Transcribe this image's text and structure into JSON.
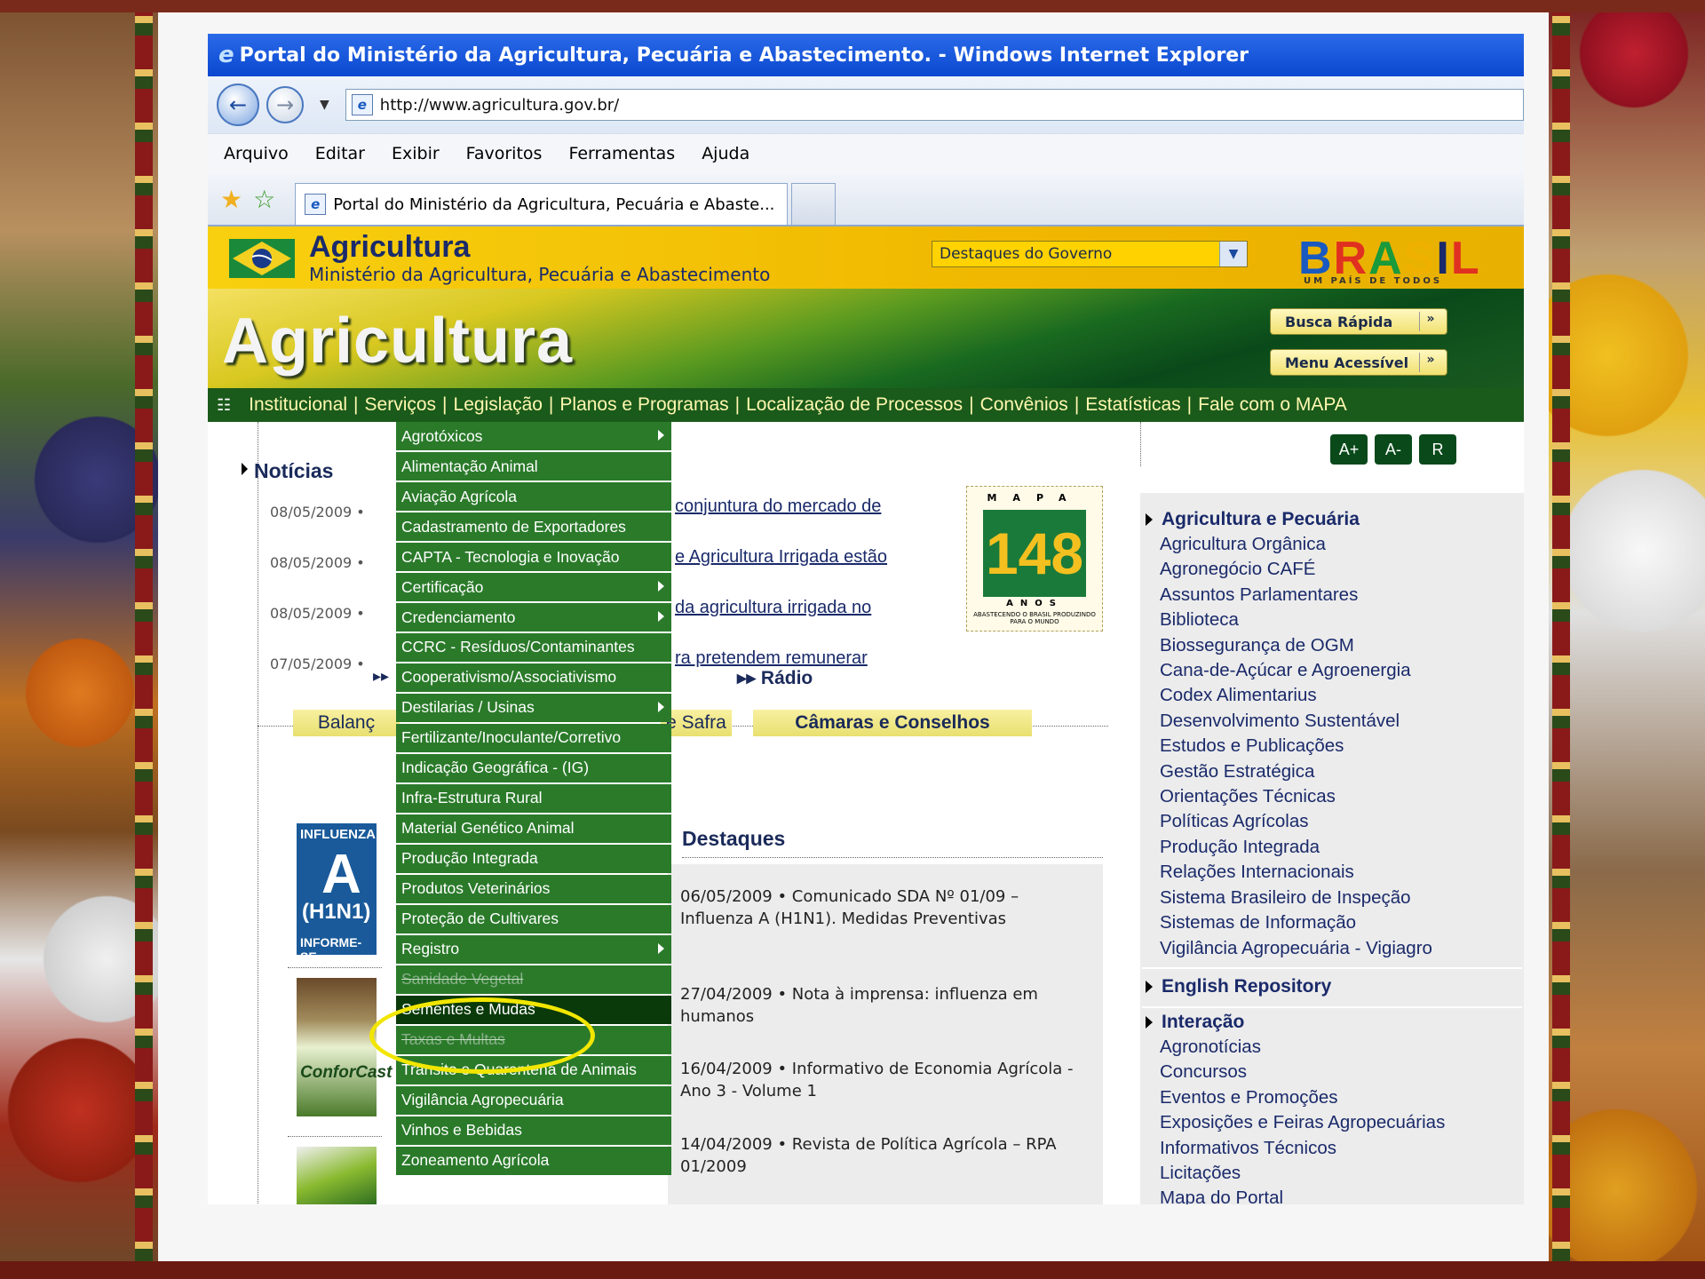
{
  "window": {
    "title": "Portal do Ministério da Agricultura, Pecuária e Abastecimento. - Windows Internet Explorer"
  },
  "address": {
    "url": "http://www.agricultura.gov.br/"
  },
  "menubar": [
    "Arquivo",
    "Editar",
    "Exibir",
    "Favoritos",
    "Ferramentas",
    "Ajuda"
  ],
  "tab": {
    "title": "Portal do Ministério da Agricultura, Pecuária e Abaste..."
  },
  "site": {
    "title": "Agricultura",
    "subtitle": "Ministério da Agricultura, Pecuária e Abastecimento",
    "banner_title": "Agricultura",
    "gov_select": "Destaques do Governo",
    "brasil_logo": "BRASIL",
    "brasil_tag": "UM PAÍS DE TODOS",
    "busca_rapida": "Busca Rápida",
    "menu_acessivel": "Menu Acessível",
    "chevrons": "»"
  },
  "nav": [
    "Institucional",
    "Serviços",
    "Legislação",
    "Planos e Programas",
    "Localização de Processos",
    "Convênios",
    "Estatísticas",
    "Fale com o MAPA"
  ],
  "services_menu": [
    {
      "label": "Agrotóxicos",
      "sub": true
    },
    {
      "label": "Alimentação Animal",
      "sub": false
    },
    {
      "label": "Aviação Agrícola",
      "sub": false
    },
    {
      "label": "Cadastramento de Exportadores",
      "sub": false
    },
    {
      "label": "CAPTA - Tecnologia e Inovação",
      "sub": false
    },
    {
      "label": "Certificação",
      "sub": true
    },
    {
      "label": "Credenciamento",
      "sub": true
    },
    {
      "label": "CCRC - Resíduos/Contaminantes",
      "sub": false
    },
    {
      "label": "Cooperativismo/Associativismo",
      "sub": false
    },
    {
      "label": "Destilarias / Usinas",
      "sub": true
    },
    {
      "label": "Fertilizante/Inoculante/Corretivo",
      "sub": false
    },
    {
      "label": "Indicação Geográfica - (IG)",
      "sub": false
    },
    {
      "label": "Infra-Estrutura Rural",
      "sub": false
    },
    {
      "label": "Material Genético Animal",
      "sub": false
    },
    {
      "label": "Produção Integrada",
      "sub": false
    },
    {
      "label": "Produtos Veterinários",
      "sub": false
    },
    {
      "label": "Proteção de Cultivares",
      "sub": false
    },
    {
      "label": "Registro",
      "sub": true
    },
    {
      "label": "Sanidade Vegetal",
      "sub": false
    },
    {
      "label": "Sementes e Mudas",
      "sub": false
    },
    {
      "label": "Taxas e Multas",
      "sub": false
    },
    {
      "label": "Trânsito e Quarentena de Animais",
      "sub": false
    },
    {
      "label": "Vigilância Agropecuária",
      "sub": false
    },
    {
      "label": "Vinhos e Bebidas",
      "sub": false
    },
    {
      "label": "Zoneamento Agrícola",
      "sub": false
    }
  ],
  "selected_menu_item": "Sementes e Mudas",
  "news": {
    "heading": "Notícias",
    "items": [
      {
        "date": "08/05/2009 •",
        "text": "conjuntura do mercado de"
      },
      {
        "date": "08/05/2009 •",
        "text": "e Agricultura Irrigada estão"
      },
      {
        "date": "08/05/2009 •",
        "text": "da agricultura irrigada no"
      },
      {
        "date": "07/05/2009 •",
        "text": "ra pretendem remunerar"
      }
    ],
    "more_arrows": "▸▸",
    "radio": "Rádio"
  },
  "stamp": {
    "top": "MAPA",
    "number": "148",
    "anos": "ANOS",
    "motto": "ABASTECENDO O BRASIL PRODUZINDO PARA O MUNDO"
  },
  "bottom_tabs": [
    "Balanç",
    "e Safra",
    "Câmaras e Conselhos"
  ],
  "destaques": {
    "heading": "Destaques",
    "items": [
      "06/05/2009 • Comunicado SDA Nº 01/09 – Influenza A (H1N1). Medidas Preventivas",
      "27/04/2009 • Nota à imprensa: influenza em humanos",
      "16/04/2009 • Informativo de Economia Agrícola - Ano 3 - Volume 1",
      "14/04/2009 • Revista de Política Agrícola – RPA 01/2009"
    ]
  },
  "h1n1": {
    "l1": "INFLUENZA",
    "l2": "A",
    "l3": "(H1N1)",
    "l4": "INFORME-SE"
  },
  "confor": "ConforCast",
  "font_buttons": [
    "A+",
    "A-",
    "R"
  ],
  "sidebar": {
    "section1": "Agricultura e Pecuária",
    "links1": [
      "Agricultura Orgânica",
      "Agronegócio CAFÉ",
      "Assuntos Parlamentares",
      "Biblioteca",
      "Biossegurança de OGM",
      "Cana-de-Açúcar e Agroenergia",
      "Codex Alimentarius",
      "Desenvolvimento Sustentável",
      "Estudos e Publicações",
      "Gestão Estratégica",
      "Orientações Técnicas",
      "Políticas Agrícolas",
      "Produção Integrada",
      "Relações Internacionais",
      "Sistema Brasileiro de Inspeção",
      "Sistemas de Informação",
      "Vigilância Agropecuária - Vigiagro"
    ],
    "section2": "English Repository",
    "section3": "Interação",
    "links3": [
      "Agronotícias",
      "Concursos",
      "Eventos e Promoções",
      "Exposições e Feiras Agropecuárias",
      "Informativos Técnicos",
      "Licitações",
      "Mapa do Portal"
    ]
  }
}
